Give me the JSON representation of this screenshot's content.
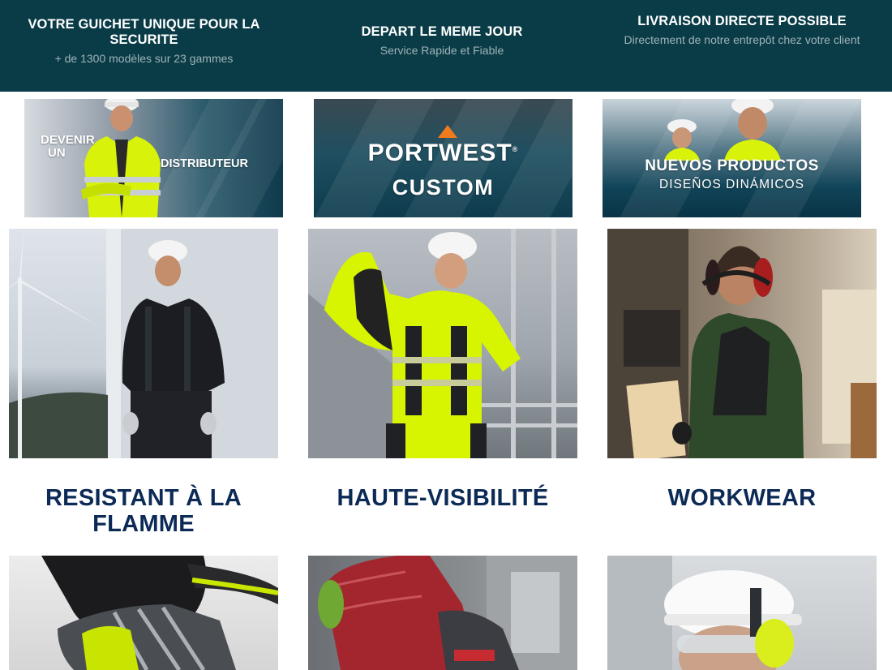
{
  "features": [
    {
      "title": "VOTRE GUICHET UNIQUE POUR LA SECURITE",
      "subtitle": "+ de 1300 modèles sur 23 gammes"
    },
    {
      "title": "DEPART LE MEME JOUR",
      "subtitle": "Service Rapide et Fiable"
    },
    {
      "title": "LIVRAISON DIRECTE POSSIBLE",
      "subtitle": "Directement de notre entrepôt chez votre client"
    }
  ],
  "promos": {
    "distributor": {
      "line1": "DEVENIR",
      "line2": "UN",
      "line3": "DISTRIBUTEUR"
    },
    "custom": {
      "logo": "PORTWEST",
      "trademark": "®",
      "label": "CUSTOM"
    },
    "new_products": {
      "line1": "NUEVOS PRODUCTOS",
      "line2": "DISEÑOS DINÁMICOS"
    }
  },
  "categories": [
    {
      "title": "RESISTANT À LA FLAMME"
    },
    {
      "title": "HAUTE-VISIBILITÉ"
    },
    {
      "title": "WORKWEAR"
    }
  ],
  "colors": {
    "topbar": "#0a3c47",
    "category_title": "#0c2a56",
    "hi_vis_yellow": "#d9f20a",
    "brand_orange": "#f07a1e"
  }
}
